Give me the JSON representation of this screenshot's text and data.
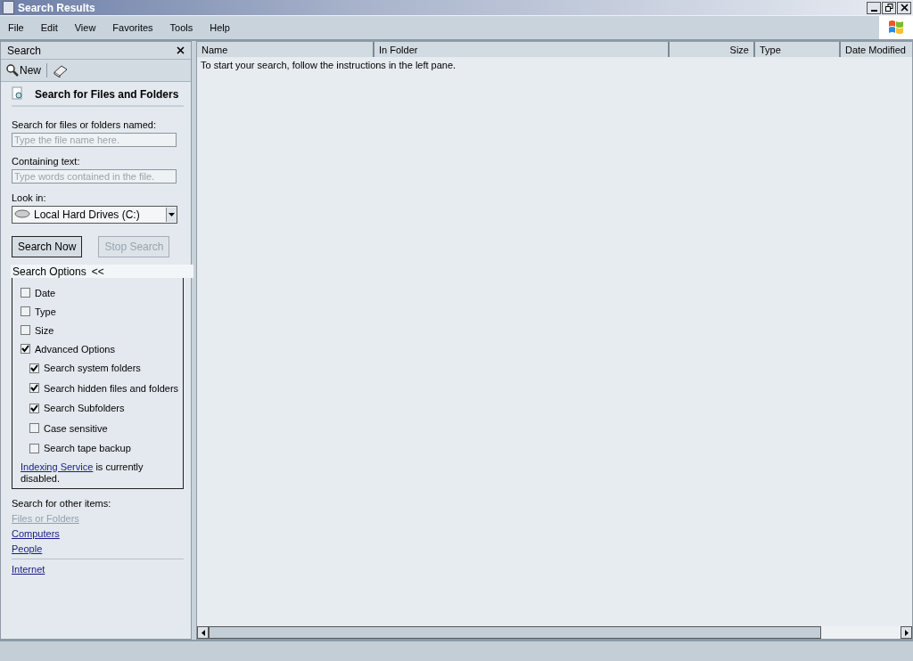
{
  "window": {
    "title": "Search Results"
  },
  "menu": [
    "File",
    "Edit",
    "View",
    "Favorites",
    "Tools",
    "Help"
  ],
  "search_pane": {
    "title": "Search",
    "toolbar": {
      "new_label": "New"
    },
    "heading": "Search for Files and Folders",
    "name_field": {
      "label": "Search for files or folders named:",
      "placeholder": "Type the file name here."
    },
    "text_field": {
      "label": "Containing text:",
      "placeholder": "Type words contained in the file."
    },
    "look_in": {
      "label": "Look in:",
      "value": "Local Hard Drives (C:)"
    },
    "buttons": [
      {
        "label": "Search Now",
        "disabled": false
      },
      {
        "label": "Stop Search",
        "disabled": true
      }
    ],
    "options": {
      "title": "Search Options",
      "toggle": "<<",
      "items": [
        {
          "label": "Date",
          "checked": false
        },
        {
          "label": "Type",
          "checked": false
        },
        {
          "label": "Size",
          "checked": false
        },
        {
          "label": "Advanced Options",
          "checked": true,
          "children": [
            {
              "label": "Search system folders",
              "checked": true
            },
            {
              "label": "Search hidden files and folders",
              "checked": true
            },
            {
              "label": "Search Subfolders",
              "checked": true
            },
            {
              "label": "Case sensitive",
              "checked": false
            },
            {
              "label": "Search tape backup",
              "checked": false
            }
          ]
        }
      ],
      "note": {
        "link": "Indexing Service",
        "text": " is currently disabled."
      }
    },
    "other": {
      "label": "Search for other items:",
      "links": [
        {
          "label": "Files or Folders",
          "disabled": true
        },
        {
          "label": "Computers",
          "disabled": false
        },
        {
          "label": "People",
          "disabled": false
        }
      ],
      "extra_link": "Internet"
    }
  },
  "results": {
    "columns": [
      "Name",
      "In Folder",
      "Size",
      "Type",
      "Date Modified"
    ],
    "message": "To start your search, follow the instructions in the left pane."
  }
}
